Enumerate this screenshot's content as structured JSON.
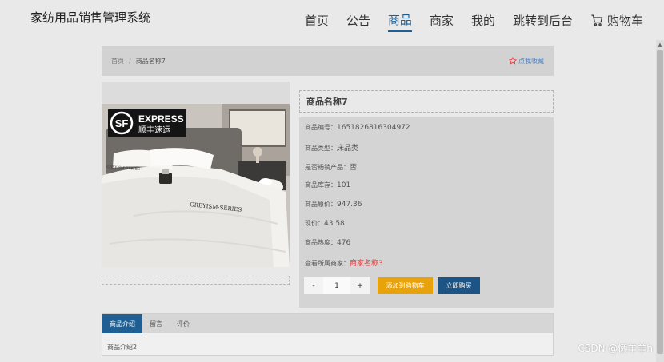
{
  "header": {
    "title": "家纺用品销售管理系统",
    "nav": [
      "首页",
      "公告",
      "商品",
      "商家",
      "我的",
      "跳转到后台"
    ],
    "cart_label": "购物车"
  },
  "breadcrumb": {
    "home": "首页",
    "separator": "/",
    "current": "商品名称7",
    "favorite": "点我收藏"
  },
  "product": {
    "name": "商品名称7",
    "rows": [
      {
        "label": "商品编号：",
        "value": "1651826816304972"
      },
      {
        "label": "商品类型：",
        "value": "床品类"
      },
      {
        "label": "是否畅销产品：",
        "value": "否"
      },
      {
        "label": "商品库存：",
        "value": "101"
      },
      {
        "label": "商品原价：",
        "value": "947.36"
      },
      {
        "label": "现价：",
        "value": "43.58"
      },
      {
        "label": "商品热度：",
        "value": "476"
      }
    ],
    "merchant_label": "查看所属商家：",
    "merchant_link": "商家名称3",
    "image_brand_text": "EXPRESS",
    "image_brand_text_cn": "顺丰速运",
    "image_bedding_text": "GREYISM·SERIES"
  },
  "purchase": {
    "minus": "-",
    "quantity": "1",
    "plus": "+",
    "add_to_cart": "添加到购物车",
    "buy_now": "立即购买"
  },
  "tabs": {
    "items": [
      "商品介绍",
      "留言",
      "评价"
    ],
    "content": "商品介绍2"
  },
  "watermark": "CSDN @懒羊羊h",
  "colors": {
    "accent": "#1f5f93",
    "add_cart": "#e8a20c",
    "buy_now": "#1c5585",
    "link_red": "#e23d3d"
  }
}
